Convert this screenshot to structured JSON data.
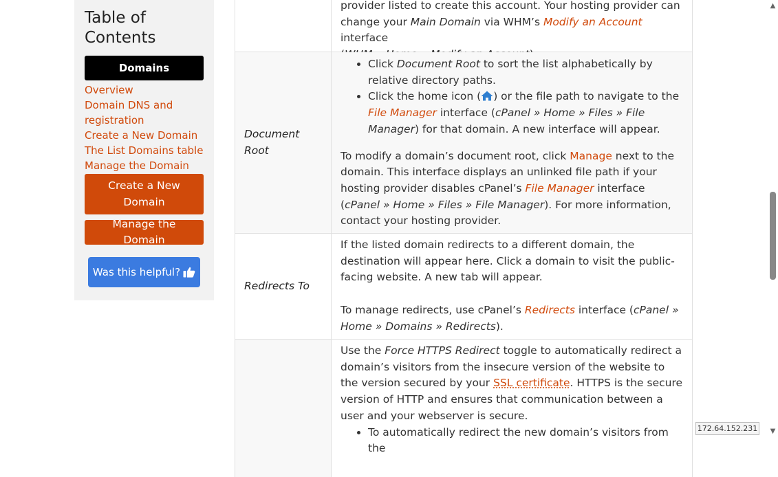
{
  "toc": {
    "title": "Table of Contents",
    "active": "Domains",
    "links": [
      "Overview",
      "Domain DNS and registration",
      "Create a New Domain",
      "The List Domains table",
      "Manage the Domain"
    ],
    "create_button": "Create a New Domain",
    "manage_button": "Manage the Domain",
    "helpful_button": "Was this helpful?"
  },
  "rows": {
    "top": {
      "line1": "provider listed to create this account. Your hosting provider can",
      "t1": "change your ",
      "main_domain": "Main Domain",
      "t2": " via WHM’s ",
      "modify_link": "Modify an Account",
      "t3": " interface",
      "t4": "(",
      "path": "WHM » Home » Modify an Account",
      "t5": ")."
    },
    "docroot": {
      "label": "Document Root",
      "b1_a": "Click ",
      "b1_em": "Document Root",
      "b1_b": " to sort the list alphabetically by relative directory paths.",
      "b2_a": "Click the home icon (",
      "b2_b": ") or the file path to navigate to the ",
      "b2_link": "File Manager",
      "b2_c": " interface (",
      "b2_path": "cPanel » Home » Files » File Manager",
      "b2_d": ") for that domain. A new interface will appear.",
      "p_a": "To modify a domain’s document root, click ",
      "p_manage": "Manage",
      "p_b": " next to the domain. This interface displays an unlinked file path if your hosting provider disables cPanel’s ",
      "p_link": "File Manager",
      "p_c": " interface (",
      "p_path": "cPanel » Home » Files » File Manager",
      "p_d": "). For more information, contact your hosting provider."
    },
    "redirects": {
      "label": "Redirects To",
      "p1": "If the listed domain redirects to a different domain, the destination will appear here. Click a domain to visit the public-facing website. A new tab will appear.",
      "p2_a": "To manage redirects, use cPanel’s ",
      "p2_link": "Redirects",
      "p2_b": " interface (",
      "p2_path": "cPanel » Home » Domains » Redirects",
      "p2_c": ")."
    },
    "https": {
      "p_a": "Use the ",
      "p_em": "Force HTTPS Redirect",
      "p_b": " toggle to automatically redirect a domain’s visitors from the insecure version of the website to the version secured by your ",
      "p_ssl": "SSL certificate",
      "p_c": ". HTTPS is the secure version of HTTP and ensures that communication between a user and your webserver is secure.",
      "b1": "To automatically redirect the new domain’s visitors from the"
    }
  },
  "ip_address": "172.64.152.231",
  "colors": {
    "accent": "#d04a0a",
    "helpful": "#3b7be0",
    "active_bg": "#000000"
  },
  "icons": {
    "home": "home-icon",
    "thumbs_up": "thumbs-up-icon"
  }
}
